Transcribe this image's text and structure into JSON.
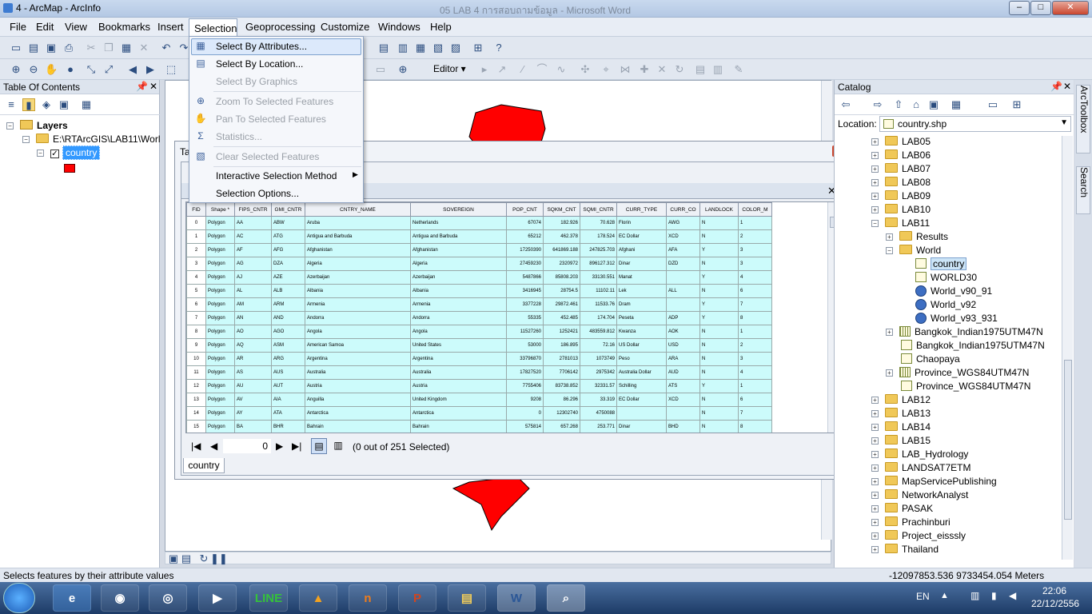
{
  "window": {
    "title": "4 - ArcMap - ArcInfo",
    "background_title": "05 LAB 4 การสอบถามข้อมูล - Microsoft Word",
    "controls": [
      "–",
      "□",
      "✕"
    ]
  },
  "menubar": [
    "File",
    "Edit",
    "View",
    "Bookmarks",
    "Insert",
    "Selection",
    "Geoprocessing",
    "Customize",
    "Windows",
    "Help"
  ],
  "selection_menu": {
    "items": [
      {
        "label": "Select By Attributes...",
        "enabled": true,
        "highlighted": true,
        "icon": "select-attributes-icon"
      },
      {
        "label": "Select By Location...",
        "enabled": true,
        "icon": "select-location-icon"
      },
      {
        "label": "Select By Graphics",
        "enabled": false,
        "icon": ""
      },
      {
        "label": "Zoom To Selected Features",
        "enabled": false,
        "icon": "zoom-selected-icon"
      },
      {
        "label": "Pan To Selected Features",
        "enabled": false,
        "icon": "pan-selected-icon"
      },
      {
        "label": "Statistics...",
        "enabled": false,
        "icon": "sigma-icon"
      },
      {
        "label": "Clear Selected Features",
        "enabled": false,
        "icon": "clear-selection-icon"
      },
      {
        "label": "Interactive Selection Method",
        "enabled": true,
        "submenu": true
      },
      {
        "label": "Selection Options...",
        "enabled": true
      }
    ]
  },
  "editor_label": "Editor ▾",
  "toc": {
    "title": "Table Of Contents",
    "layers_label": "Layers",
    "path": "E:\\RTArcGIS\\LAB11\\World",
    "layer": "country",
    "symbol_color": "#ff0000"
  },
  "catalog": {
    "title": "Catalog",
    "location_label": "Location:",
    "location_value": "country.shp",
    "items": [
      {
        "label": "LAB05",
        "type": "folder",
        "indent": 0,
        "expand": "+"
      },
      {
        "label": "LAB06",
        "type": "folder",
        "indent": 0,
        "expand": "+"
      },
      {
        "label": "LAB07",
        "type": "folder",
        "indent": 0,
        "expand": "+"
      },
      {
        "label": "LAB08",
        "type": "folder",
        "indent": 0,
        "expand": "+"
      },
      {
        "label": "LAB09",
        "type": "folder",
        "indent": 0,
        "expand": "+"
      },
      {
        "label": "LAB10",
        "type": "folder",
        "indent": 0,
        "expand": "+"
      },
      {
        "label": "LAB11",
        "type": "folder",
        "indent": 0,
        "expand": "-"
      },
      {
        "label": "Results",
        "type": "folder",
        "indent": 1,
        "expand": "+"
      },
      {
        "label": "World",
        "type": "folder",
        "indent": 1,
        "expand": "-"
      },
      {
        "label": "country",
        "type": "shp",
        "indent": 2,
        "expand": "",
        "selected": true
      },
      {
        "label": "WORLD30",
        "type": "shp",
        "indent": 2,
        "expand": ""
      },
      {
        "label": "World_v90_91",
        "type": "globe",
        "indent": 2,
        "expand": ""
      },
      {
        "label": "World_v92",
        "type": "globe",
        "indent": 2,
        "expand": ""
      },
      {
        "label": "World_v93_931",
        "type": "globe",
        "indent": 2,
        "expand": ""
      },
      {
        "label": "Bangkok_Indian1975UTM47N",
        "type": "grid",
        "indent": 1,
        "expand": "+"
      },
      {
        "label": "Bangkok_Indian1975UTM47N",
        "type": "shp",
        "indent": 1,
        "expand": ""
      },
      {
        "label": "Chaopaya",
        "type": "shp",
        "indent": 1,
        "expand": ""
      },
      {
        "label": "Province_WGS84UTM47N",
        "type": "grid",
        "indent": 1,
        "expand": "+"
      },
      {
        "label": "Province_WGS84UTM47N",
        "type": "shp",
        "indent": 1,
        "expand": ""
      },
      {
        "label": "LAB12",
        "type": "folder",
        "indent": 0,
        "expand": "+"
      },
      {
        "label": "LAB13",
        "type": "folder",
        "indent": 0,
        "expand": "+"
      },
      {
        "label": "LAB14",
        "type": "folder",
        "indent": 0,
        "expand": "+"
      },
      {
        "label": "LAB15",
        "type": "folder",
        "indent": 0,
        "expand": "+"
      },
      {
        "label": "LAB_Hydrology",
        "type": "folder",
        "indent": 0,
        "expand": "+"
      },
      {
        "label": "LANDSAT7ETM",
        "type": "folder",
        "indent": 0,
        "expand": "+"
      },
      {
        "label": "MapServicePublishing",
        "type": "folder",
        "indent": 0,
        "expand": "+"
      },
      {
        "label": "NetworkAnalyst",
        "type": "folder",
        "indent": 0,
        "expand": "+"
      },
      {
        "label": "PASAK",
        "type": "folder",
        "indent": 0,
        "expand": "+"
      },
      {
        "label": "Prachinburi",
        "type": "folder",
        "indent": 0,
        "expand": "+"
      },
      {
        "label": "Project_eisssly",
        "type": "folder",
        "indent": 0,
        "expand": "+"
      },
      {
        "label": "Thailand",
        "type": "folder",
        "indent": 0,
        "expand": "+"
      }
    ]
  },
  "right_tabs": [
    "ArcToolbox",
    "Search"
  ],
  "table": {
    "title_fragment": "Ta",
    "tab_label": "country",
    "record_position": "0",
    "selection_status": "(0 out of 251 Selected)",
    "columns": [
      "FID",
      "Shape *",
      "FIPS_CNTR",
      "GMI_CNTR",
      "CNTRY_NAME",
      "SOVEREIGN",
      "POP_CNT",
      "SQKM_CNT",
      "SQMI_CNTR",
      "CURR_TYPE",
      "CURR_CO",
      "LANDLOCK",
      "COLOR_M"
    ],
    "rows": [
      [
        "0",
        "Polygon",
        "AA",
        "ABW",
        "Aruba",
        "Netherlands",
        "67074",
        "182.926",
        "70.628",
        "Florin",
        "AWG",
        "N",
        "1"
      ],
      [
        "1",
        "Polygon",
        "AC",
        "ATG",
        "Antigua and Barbuda",
        "Antigua and Barbuda",
        "65212",
        "462.378",
        "178.524",
        "EC Dollar",
        "XCD",
        "N",
        "2"
      ],
      [
        "2",
        "Polygon",
        "AF",
        "AFG",
        "Afghanistan",
        "Afghanistan",
        "17250390",
        "641869.188",
        "247825.703",
        "Afghani",
        "AFA",
        "Y",
        "3"
      ],
      [
        "3",
        "Polygon",
        "AG",
        "DZA",
        "Algeria",
        "Algeria",
        "27459230",
        "2320972",
        "896127.312",
        "Dinar",
        "DZD",
        "N",
        "3"
      ],
      [
        "4",
        "Polygon",
        "AJ",
        "AZE",
        "Azerbaijan",
        "Azerbaijan",
        "5487866",
        "85808.203",
        "33130.551",
        "Manat",
        "",
        "Y",
        "4"
      ],
      [
        "5",
        "Polygon",
        "AL",
        "ALB",
        "Albania",
        "Albania",
        "3416945",
        "28754.5",
        "11102.11",
        "Lek",
        "ALL",
        "N",
        "6"
      ],
      [
        "6",
        "Polygon",
        "AM",
        "ARM",
        "Armenia",
        "Armenia",
        "3377228",
        "29872.461",
        "11533.76",
        "Dram",
        "",
        "Y",
        "7"
      ],
      [
        "7",
        "Polygon",
        "AN",
        "AND",
        "Andorra",
        "Andorra",
        "55335",
        "452.485",
        "174.704",
        "Peseta",
        "ADP",
        "Y",
        "8"
      ],
      [
        "8",
        "Polygon",
        "AO",
        "AGO",
        "Angola",
        "Angola",
        "11527260",
        "1252421",
        "483559.812",
        "Kwanza",
        "AOK",
        "N",
        "1"
      ],
      [
        "9",
        "Polygon",
        "AQ",
        "ASM",
        "American Samoa",
        "United States",
        "53000",
        "186.895",
        "72.16",
        "US Dollar",
        "USD",
        "N",
        "2"
      ],
      [
        "10",
        "Polygon",
        "AR",
        "ARG",
        "Argentina",
        "Argentina",
        "33796870",
        "2781013",
        "1073749",
        "Peso",
        "ARA",
        "N",
        "3"
      ],
      [
        "11",
        "Polygon",
        "AS",
        "AUS",
        "Australia",
        "Australia",
        "17827520",
        "7706142",
        "2975342",
        "Australia Dollar",
        "AUD",
        "N",
        "4"
      ],
      [
        "12",
        "Polygon",
        "AU",
        "AUT",
        "Austria",
        "Austria",
        "7755406",
        "83738.852",
        "32331.57",
        "Schilling",
        "ATS",
        "Y",
        "1"
      ],
      [
        "13",
        "Polygon",
        "AV",
        "AIA",
        "Anguilla",
        "United Kingdom",
        "9208",
        "86.296",
        "33.319",
        "EC Dollar",
        "XCD",
        "N",
        "6"
      ],
      [
        "14",
        "Polygon",
        "AY",
        "ATA",
        "Antarctica",
        "Antarctica",
        "0",
        "12302740",
        "4750088",
        "",
        "",
        "N",
        "7"
      ],
      [
        "15",
        "Polygon",
        "BA",
        "BHR",
        "Bahrain",
        "Bahrain",
        "575814",
        "657.268",
        "253.771",
        "Dinar",
        "BHD",
        "N",
        "8"
      ]
    ]
  },
  "status": {
    "message": "Selects features by their attribute values",
    "coords": "-12097853.536  9733454.054 Meters"
  },
  "taskbar": {
    "apps": [
      "start",
      "ie",
      "chrome",
      "app4",
      "media",
      "LINE",
      "app7",
      "n",
      "powerpoint",
      "explorer",
      "word",
      "arcmap"
    ],
    "lang": "EN",
    "time": "22:06",
    "date": "22/12/2556"
  }
}
